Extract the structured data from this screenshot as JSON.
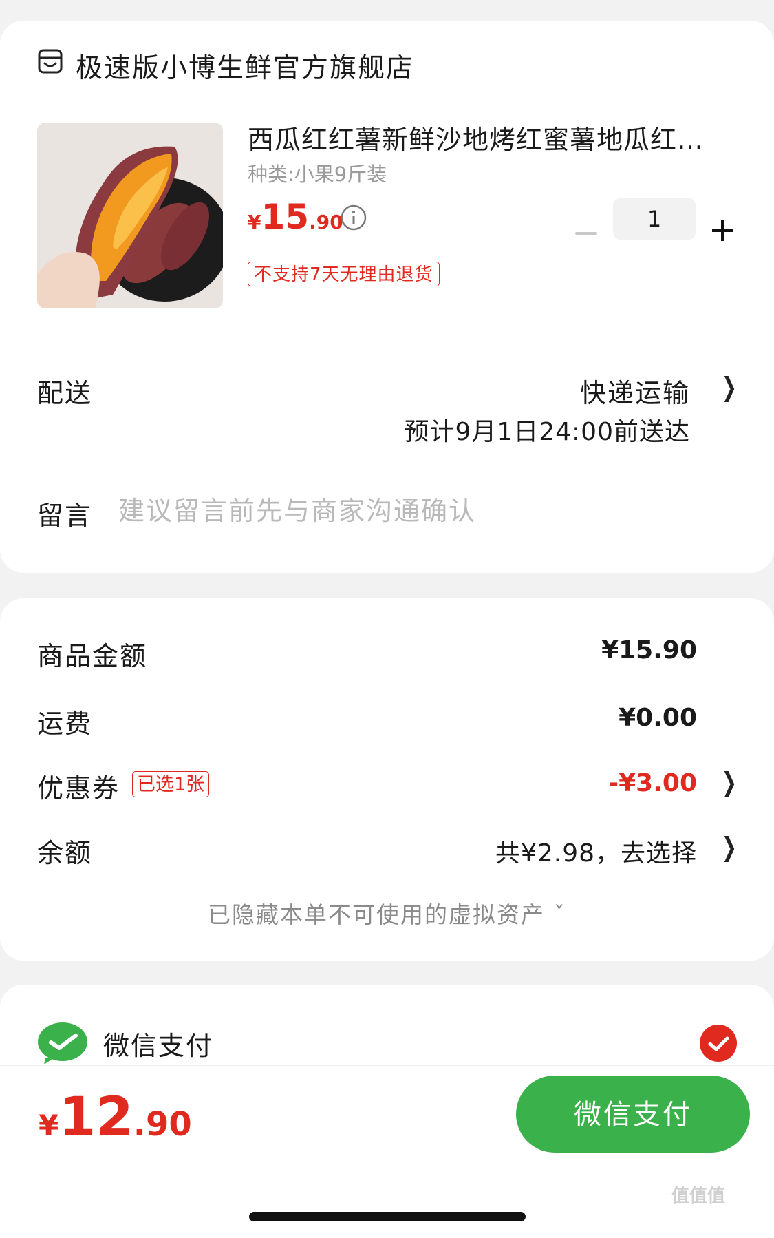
{
  "shop": {
    "name": "极速版小博生鲜官方旗舰店",
    "icon": "shop-icon"
  },
  "product": {
    "title": "西瓜红红薯新鲜沙地烤红蜜薯地瓜红…",
    "spec": "种类:小果9斤装",
    "price": {
      "currency": "¥",
      "integer": "15",
      "decimal": ".90"
    },
    "quantity": "1",
    "return_tag": "不支持7天无理由退货"
  },
  "delivery": {
    "label": "配送",
    "method": "快递运输",
    "eta": "预计9月1日24:00前送达"
  },
  "note": {
    "label": "留言",
    "placeholder": "建议留言前先与商家沟通确认"
  },
  "amounts": {
    "goods": {
      "label": "商品金额",
      "value": "¥15.90"
    },
    "shipping": {
      "label": "运费",
      "value": "¥0.00"
    },
    "coupon": {
      "label": "优惠券",
      "tag": "已选1张",
      "value": "-¥3.00"
    },
    "balance": {
      "label": "余额",
      "value": "共¥2.98，去选择"
    },
    "hidden_assets": "已隐藏本单不可使用的虚拟资产 ˇ"
  },
  "payment": {
    "method": "微信支付",
    "selected": true
  },
  "footer": {
    "total": {
      "currency": "¥",
      "integer": "12",
      "decimal": ".90"
    },
    "pay_button": "微信支付"
  },
  "watermark": "值值值",
  "colors": {
    "accent_red": "#e0291f",
    "wechat_green": "#3ab14a"
  }
}
